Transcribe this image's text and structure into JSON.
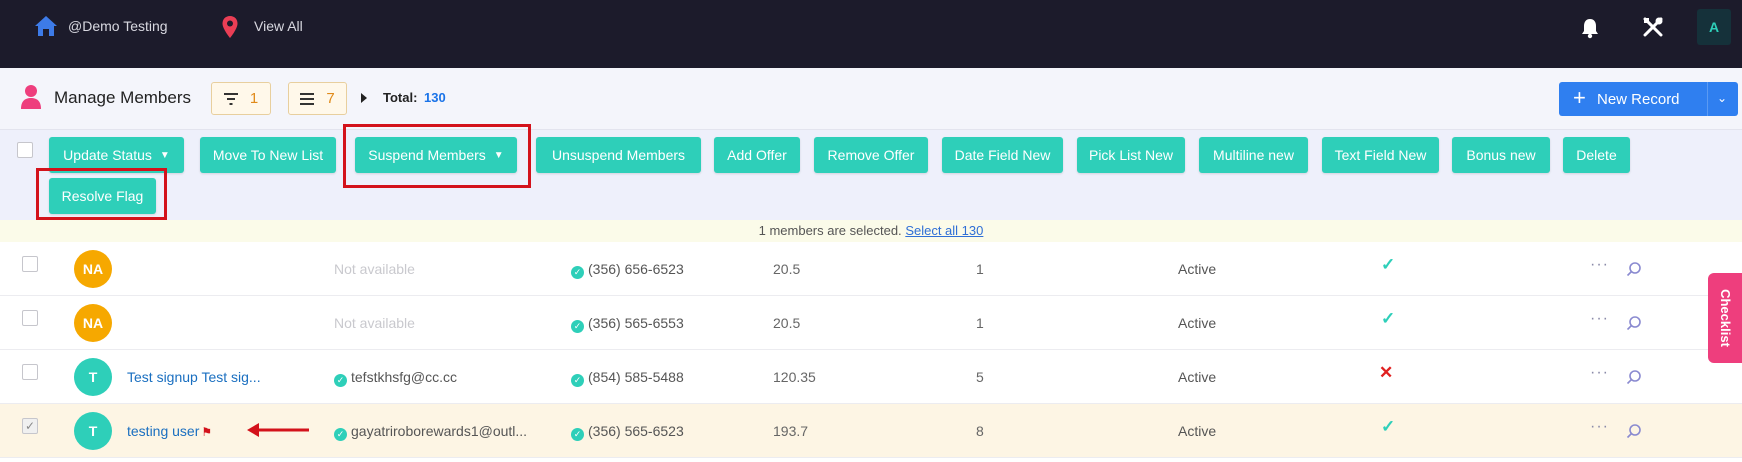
{
  "nav": {
    "home_text": "@Demo Testing",
    "location_text": "View All",
    "avatar_initial": "A"
  },
  "header": {
    "title": "Manage Members",
    "filter_count": "1",
    "list_count": "7",
    "total_label": "Total:",
    "total_value": "130",
    "new_record_label": "New Record"
  },
  "actions": [
    {
      "label": "Update Status",
      "dropdown": true
    },
    {
      "label": "Move To New List"
    },
    {
      "label": "Suspend Members",
      "dropdown": true
    },
    {
      "label": "Unsuspend Members"
    },
    {
      "label": "Add Offer"
    },
    {
      "label": "Remove Offer"
    },
    {
      "label": "Date Field New"
    },
    {
      "label": "Pick List New"
    },
    {
      "label": "Multiline new"
    },
    {
      "label": "Text Field New"
    },
    {
      "label": "Bonus new"
    },
    {
      "label": "Delete"
    },
    {
      "label": "Resolve Flag"
    }
  ],
  "selection": {
    "text": "1 members are selected.",
    "link": "Select all 130"
  },
  "rows": [
    {
      "selected": false,
      "initials": "NA",
      "avatar_color": "#f6a800",
      "name": "",
      "email": "Not available",
      "email_available": false,
      "phone": "(356) 656-6523",
      "amount": "20.5",
      "count": "1",
      "status": "Active",
      "verified": true
    },
    {
      "selected": false,
      "initials": "NA",
      "avatar_color": "#f6a800",
      "name": "",
      "email": "Not available",
      "email_available": false,
      "phone": "(356) 565-6553",
      "amount": "20.5",
      "count": "1",
      "status": "Active",
      "verified": true
    },
    {
      "selected": false,
      "initials": "T",
      "avatar_color": "#2ecfb9",
      "name": "Test signup Test sig...",
      "email": "tefstkhsfg@cc.cc",
      "email_available": true,
      "phone": "(854) 585-5488",
      "amount": "120.35",
      "count": "5",
      "status": "Active",
      "verified": false
    },
    {
      "selected": true,
      "initials": "T",
      "avatar_color": "#2ecfb9",
      "name": "testing user",
      "flagged": true,
      "email": "gayatriroborewards1@outl...",
      "email_available": true,
      "phone": "(356) 565-6523",
      "amount": "193.7",
      "count": "8",
      "status": "Active",
      "verified": true
    }
  ],
  "checklist_label": "Checklist",
  "colors": {
    "accent": "#2ecfb9",
    "primary": "#2f7ff0",
    "highlight": "#d3121b",
    "nav_bg": "#1c1b2b",
    "checklist": "#ee3e7d"
  }
}
